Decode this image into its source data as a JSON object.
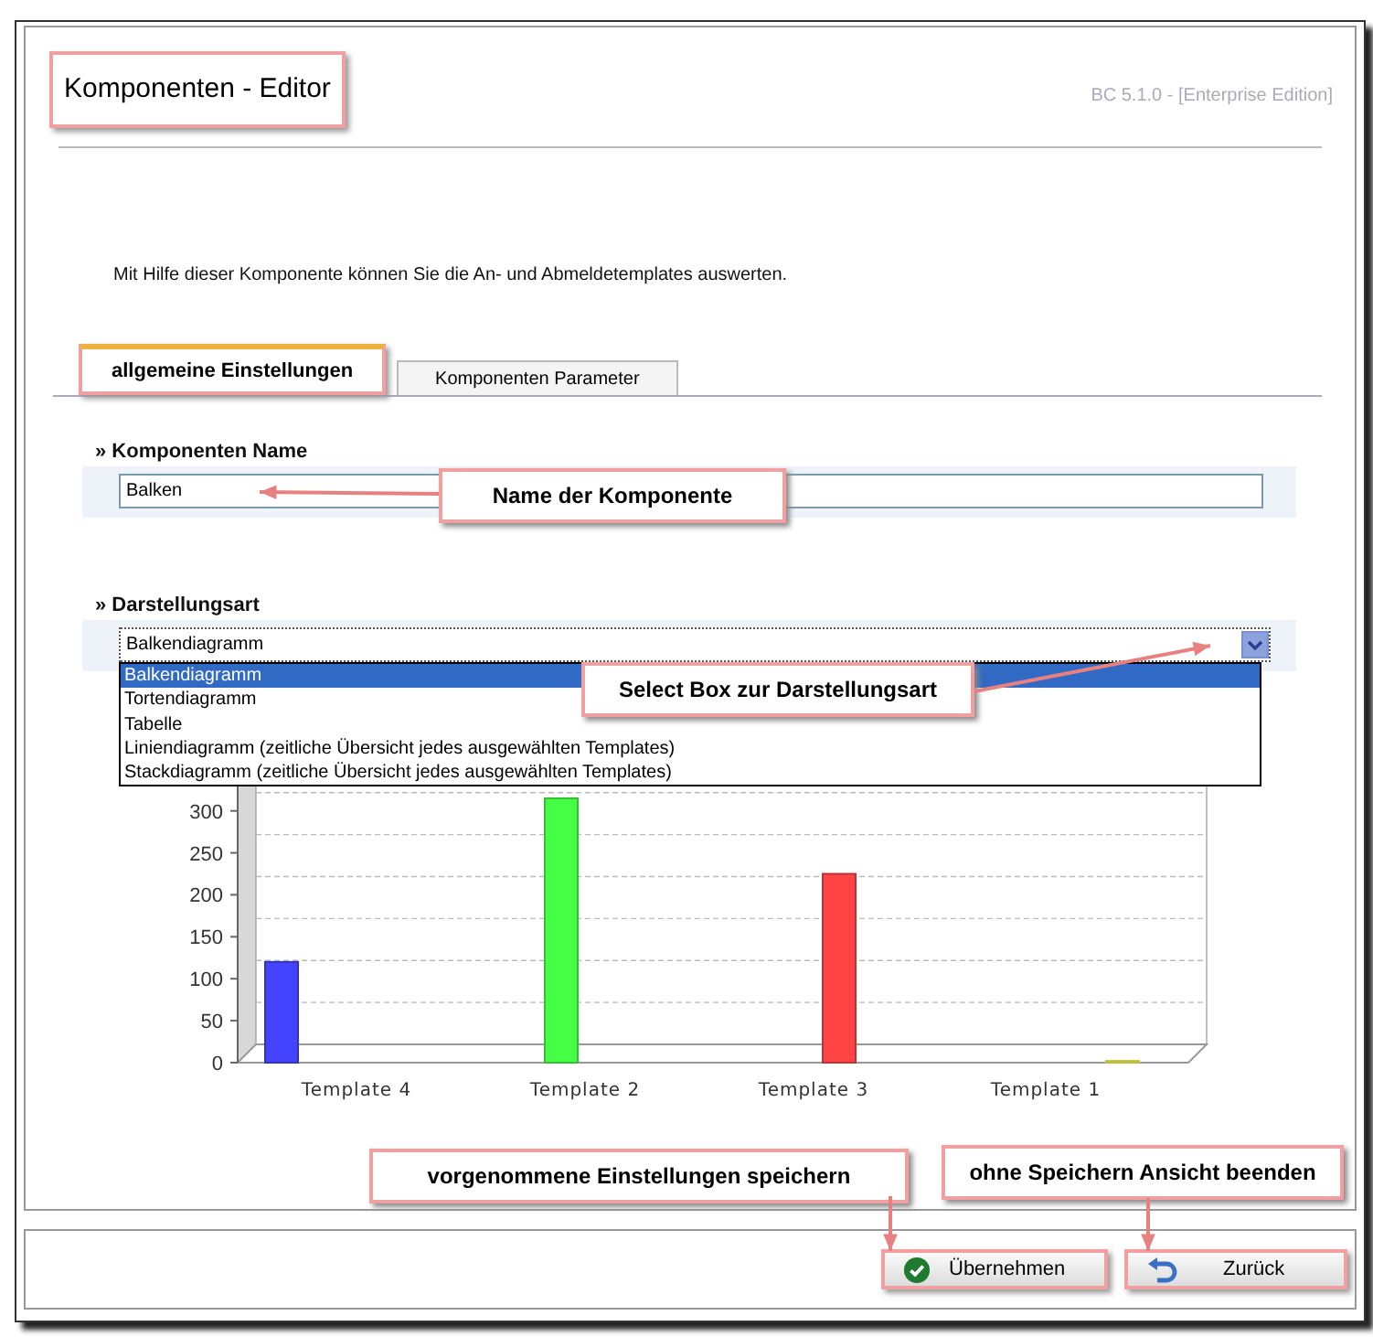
{
  "header": {
    "title": "Komponenten - Editor",
    "version": "BC 5.1.0 - [Enterprise Edition]"
  },
  "description": "Mit Hilfe dieser Komponente können Sie die An- und Abmeldetemplates auswerten.",
  "tabs": [
    {
      "label": "allgemeine Einstellungen",
      "selected": true
    },
    {
      "label": "Komponenten Parameter",
      "selected": false
    }
  ],
  "fields": [
    {
      "kind": "text",
      "label": "» Komponenten Name",
      "value": "Balken"
    },
    {
      "kind": "select",
      "label": "» Darstellungsart",
      "value": "Balkendiagramm",
      "expanded": true,
      "options": [
        {
          "label": "Balkendiagramm",
          "selected": true
        },
        {
          "label": "Tortendiagramm",
          "selected": false
        },
        {
          "label": "Tabelle",
          "selected": false
        },
        {
          "label": "Liniendiagramm (zeitliche Übersicht jedes ausgewählten Templates)",
          "selected": false
        },
        {
          "label": "Stackdiagramm (zeitliche Übersicht jedes ausgewählten Templates)",
          "selected": false
        }
      ]
    }
  ],
  "chart": {
    "chart_data": {
      "type": "bar",
      "categories": [
        "Template 4",
        "Template 2",
        "Template 3",
        "Template 1"
      ],
      "series": [
        {
          "values": [
            120,
            315,
            225,
            2
          ]
        }
      ],
      "colors": [
        "#4444ff",
        "#44ff44",
        "#ff4444",
        "#ffff44"
      ],
      "ylim": [
        0,
        340
      ],
      "yticks": [
        0,
        50,
        100,
        150,
        200,
        250,
        300
      ]
    }
  },
  "buttons": [
    {
      "kind": "confirm",
      "label": "Übernehmen"
    },
    {
      "kind": "back",
      "label": "Zurück"
    }
  ],
  "annotations": [
    {
      "text": "Name der Komponente"
    },
    {
      "text": "Select Box zur Darstellungsart"
    },
    {
      "text": "vorgenommene Einstellungen speichern"
    },
    {
      "text": "ohne Speichern Ansicht beenden"
    }
  ]
}
